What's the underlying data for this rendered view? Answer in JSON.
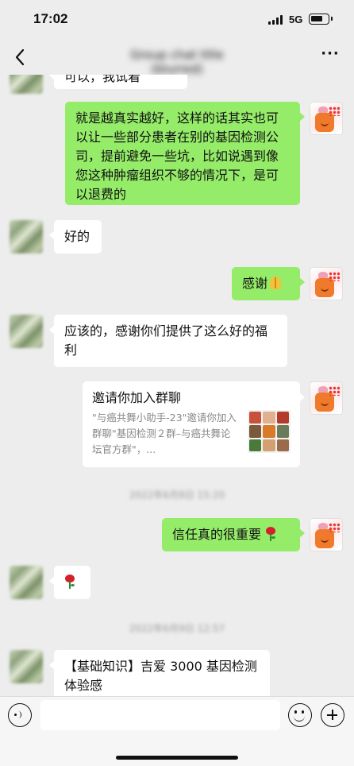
{
  "status_bar": {
    "time": "17:02",
    "network": "5G",
    "battery_icon": "battery-icon",
    "signal_icon": "signal-icon"
  },
  "nav": {
    "title": "Group chat title (blurred)",
    "back_icon": "chevron-left-icon",
    "more_icon": "more-dots-icon"
  },
  "messages": [
    {
      "side": "left",
      "text": "可以，我试着",
      "partial": true
    },
    {
      "side": "right",
      "text": "就是越真实越好，这样的话其实也可以让一些部分患者在别的基因检测公司，提前避免一些坑，比如说遇到像您这种肿瘤组织不够的情况下，是可以退费的"
    },
    {
      "side": "left",
      "text": "好的"
    },
    {
      "side": "right",
      "text": "感谢",
      "emoji": "folded-hands-icon"
    },
    {
      "side": "left",
      "text": "应该的，感谢你们提供了这么好的福利"
    },
    {
      "side": "right",
      "type": "group-invite-card",
      "title": "邀请你加入群聊",
      "description": "\"与癌共舞小助手-23\"邀请你加入群聊\"基因检测２群–与癌共舞论坛官方群\"，..."
    },
    {
      "type": "timestamp",
      "text": "2022年6月8日 15:20"
    },
    {
      "side": "right",
      "text": "信任真的很重要",
      "emoji": "rose-icon"
    },
    {
      "side": "left",
      "text": "",
      "emoji": "rose-icon"
    },
    {
      "type": "timestamp",
      "text": "2022年6月9日 12:57"
    },
    {
      "side": "left",
      "text": "【基础知识】吉爱 3000 基因检测体验感"
    }
  ],
  "input_bar": {
    "placeholder": "",
    "voice_icon": "voice-icon",
    "emoji_icon": "emoji-icon",
    "plus_icon": "plus-icon"
  },
  "colors": {
    "background": "#ededed",
    "bubble_right": "#95ec69",
    "bubble_left": "#ffffff",
    "invite_muted_text": "#888888"
  }
}
